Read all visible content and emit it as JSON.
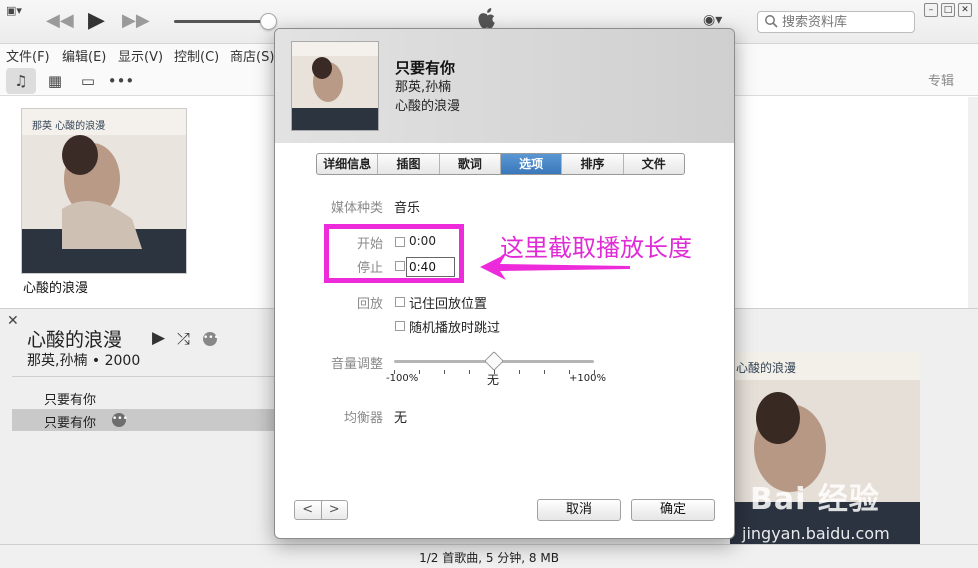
{
  "window": {
    "controls": {
      "menu": "▣▾",
      "prev": "◀◀",
      "play": "▶",
      "next": "▶▶"
    },
    "account": "◉▾",
    "search": {
      "placeholder": "搜索资料库"
    },
    "win_buttons": [
      "–",
      "□",
      "✕"
    ]
  },
  "menubar": [
    "文件(F)",
    "编辑(E)",
    "显示(V)",
    "控制(C)",
    "商店(S)"
  ],
  "mediabar": {
    "items": [
      {
        "icon": "music-note-icon",
        "glyph": "♫"
      },
      {
        "icon": "film-icon",
        "glyph": "▦"
      },
      {
        "icon": "tv-icon",
        "glyph": "▭"
      },
      {
        "icon": "more-icon",
        "glyph": "•••"
      }
    ],
    "album_link": "专辑"
  },
  "library": {
    "album_caption": "心酸的浪漫"
  },
  "detail": {
    "close": "✕",
    "album_title": "心酸的浪漫",
    "artist_year": "那英,孙楠 • 2000",
    "tracks": [
      "只要有你",
      "只要有你"
    ],
    "more": "•••"
  },
  "status": "1/2 首歌曲, 5 分钟, 8 MB",
  "watermark": {
    "logo": "Bai 经验",
    "url": "jingyan.baidu.com"
  },
  "dialog": {
    "title": "只要有你",
    "artist": "那英,孙楠",
    "album": "心酸的浪漫",
    "tabs": [
      "详细信息",
      "插图",
      "歌词",
      "选项",
      "排序",
      "文件"
    ],
    "active_tab": "选项",
    "media_kind_label": "媒体种类",
    "media_kind_value": "音乐",
    "start_label": "开始",
    "start_value": "0:00",
    "stop_label": "停止",
    "stop_value": "0:40",
    "playback_label": "回放",
    "remember_position": "记住回放位置",
    "skip_shuffle": "随机播放时跳过",
    "volume_label": "音量调整",
    "volume_min": "-100%",
    "volume_mid": "无",
    "volume_max": "+100%",
    "volume_adjust": 0,
    "eq_label": "均衡器",
    "eq_value": "无",
    "nav_prev": "<",
    "nav_next": ">",
    "cancel": "取消",
    "ok": "确定"
  },
  "annotation": {
    "text": "这里截取播放长度",
    "color": "#e02cd6"
  }
}
